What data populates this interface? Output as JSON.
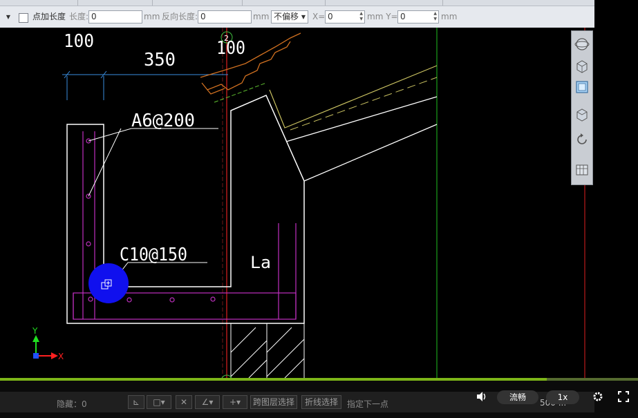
{
  "toolbar": {
    "add_length_label": "点加长度",
    "length_label": "长度:",
    "length_value": "0",
    "unit_mm": "mm",
    "reverse_length_label": "反向长度:",
    "reverse_length_value": "0",
    "offset_select": "不偏移",
    "x_label": "X=",
    "x_value": "0",
    "y_label": "mm Y=",
    "y_value": "0"
  },
  "drawing": {
    "dim_100_left": "100",
    "dim_350": "350",
    "dim_100_right": "100",
    "axis_2": "2",
    "rebar_a6": "A6@200",
    "rebar_c10": "C10@150",
    "la_label": "La",
    "ucs_y": "Y",
    "ucs_x": "X"
  },
  "status": {
    "hidden_label": "隐藏：0",
    "cross_layer": "跨图层选择",
    "polyline_select": "折线选择",
    "prompt": "指定下一点",
    "scale": "500 ..."
  },
  "player": {
    "quality": "流畅",
    "speed": "1x",
    "progress": 0.857
  },
  "colors": {
    "accent_green": "#7cb518",
    "cursor_blue": "#1010ee"
  }
}
